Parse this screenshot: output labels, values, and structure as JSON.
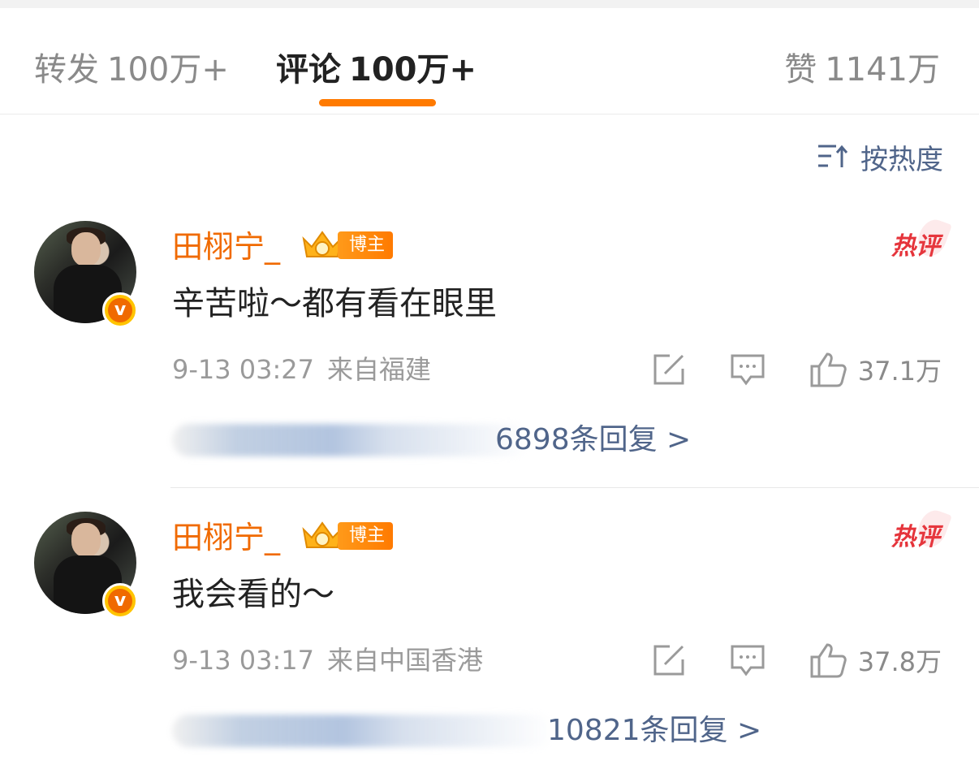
{
  "tabs": {
    "repost": {
      "label": "转发",
      "count": "100万+"
    },
    "comment": {
      "label": "评论",
      "count": "100万+"
    },
    "like": {
      "label": "赞",
      "count": "1141万"
    }
  },
  "sort": {
    "label": "按热度",
    "icon": "sort-icon"
  },
  "comments": [
    {
      "username": "田栩宁_",
      "badge": "博主",
      "hot": "热评",
      "text": "辛苦啦～都有看在眼里",
      "date": "9-13 03:27",
      "location": "来自福建",
      "likes": "37.1万",
      "replies": "6898条回复 >"
    },
    {
      "username": "田栩宁_",
      "badge": "博主",
      "hot": "热评",
      "text": "我会看的～",
      "date": "9-13 03:17",
      "location": "来自中国香港",
      "likes": "37.8万",
      "replies": "10821条回复 >"
    }
  ],
  "colors": {
    "accent": "#ff7a00",
    "username": "#f06a00",
    "link": "#50658a",
    "hot": "#e5343b"
  }
}
